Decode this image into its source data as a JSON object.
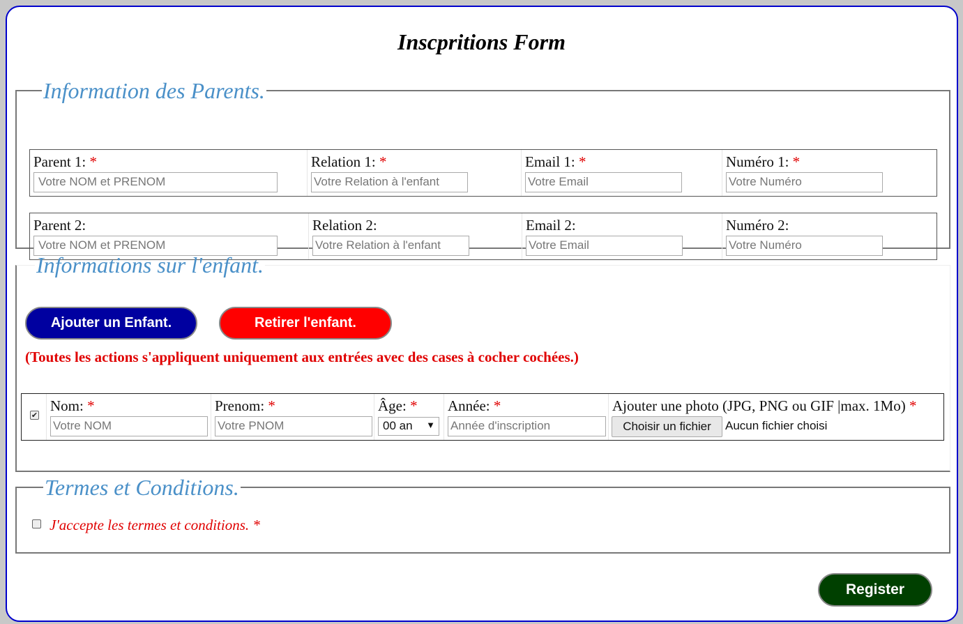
{
  "form": {
    "title": "Inscpritions Form"
  },
  "parents": {
    "legend": "Information des Parents.",
    "required_mark": "*",
    "rows": [
      {
        "parent_label": "Parent 1:",
        "parent_placeholder": "Votre NOM et PRENOM",
        "relation_label": "Relation 1:",
        "relation_placeholder": "Votre Relation à l'enfant",
        "email_label": "Email 1:",
        "email_placeholder": "Votre Email",
        "numero_label": "Numéro 1:",
        "numero_placeholder": "Votre Numéro",
        "required": true
      },
      {
        "parent_label": "Parent 2:",
        "parent_placeholder": "Votre NOM et PRENOM",
        "relation_label": "Relation 2:",
        "relation_placeholder": "Votre Relation à l'enfant",
        "email_label": "Email 2:",
        "email_placeholder": "Votre Email",
        "numero_label": "Numéro 2:",
        "numero_placeholder": "Votre Numéro",
        "required": false
      }
    ]
  },
  "children": {
    "legend": "Informations sur l'enfant.",
    "add_button": "Ajouter un Enfant.",
    "remove_button": "Retirer l'enfant.",
    "notice": "(Toutes les actions s'appliquent uniquement aux entrées avec des cases à cocher cochées.)",
    "row": {
      "checked": true,
      "nom_label": "Nom:",
      "nom_placeholder": "Votre NOM",
      "prenom_label": "Prenom:",
      "prenom_placeholder": "Votre PNOM",
      "age_label": "Âge:",
      "age_value": "00 an",
      "annee_label": "Année:",
      "annee_placeholder": "Année d'inscription",
      "photo_label": "Ajouter une photo (JPG, PNG ou GIF |max. 1Mo)",
      "file_button": "Choisir un fichier",
      "file_status": "Aucun fichier choisi"
    }
  },
  "terms": {
    "legend": "Termes et Conditions.",
    "checkbox_label": "J'accepte les termes et conditions.",
    "checked": false
  },
  "actions": {
    "register_label": "Register"
  },
  "colors": {
    "frame_border": "#0000cc",
    "legend": "#4a90c8",
    "required": "#e00000",
    "add_button": "#0000a0",
    "remove_button": "#ff0000",
    "register_button": "#004000"
  }
}
